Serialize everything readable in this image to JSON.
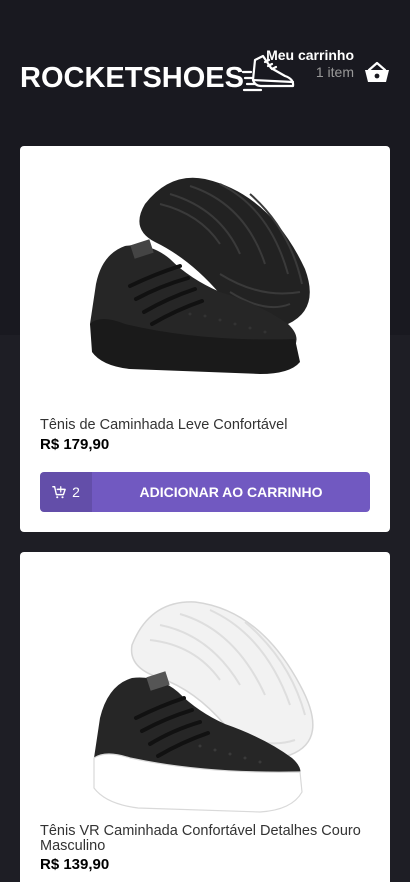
{
  "header": {
    "logo": "ROCKETSHOES",
    "cart": {
      "title": "Meu carrinho",
      "count": "1 item"
    }
  },
  "products": [
    {
      "title": "Tênis de Caminhada Leve Confortável",
      "price": "R$ 179,90",
      "cart_amount": "2",
      "button_label": "ADICIONAR AO CARRINHO",
      "sole_color": "#1a1a1a"
    },
    {
      "title": "Tênis VR Caminhada Confortável Detalhes Couro Masculino",
      "price": "R$ 139,90",
      "sole_color": "#ffffff"
    }
  ],
  "colors": {
    "background": "#191920",
    "accent": "#7159c1"
  }
}
